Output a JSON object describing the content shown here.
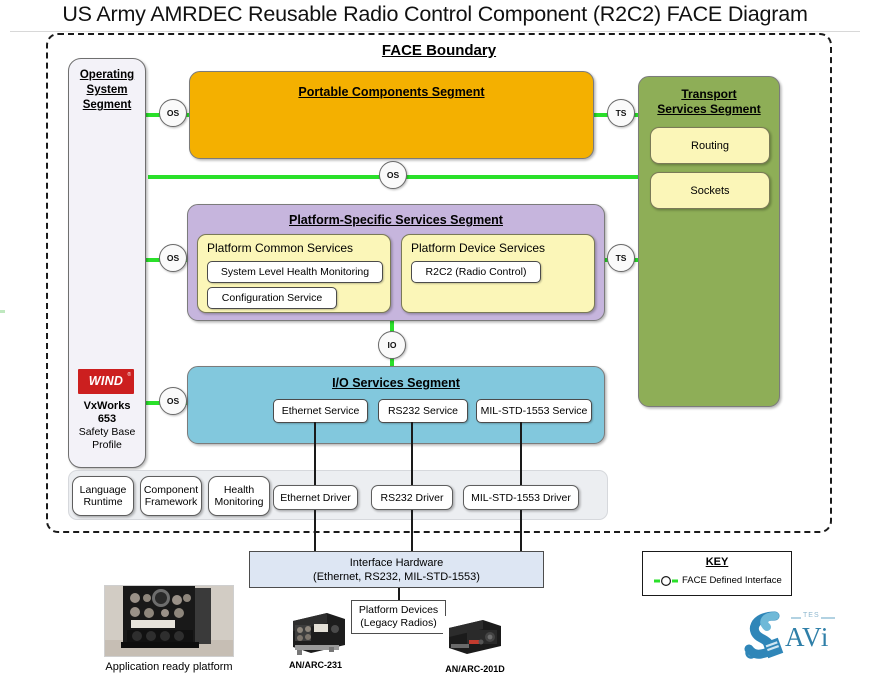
{
  "title": "US Army AMRDEC Reusable Radio Control Component (R2C2) FACE Diagram",
  "face_boundary": {
    "label": "FACE Boundary"
  },
  "os_segment": {
    "title": "Operating System Segment",
    "title_lines": [
      "Operating",
      "System",
      "Segment"
    ],
    "vendor_logo_text": "WIND",
    "vendor_logo_tm": "®",
    "os_name": "VxWorks",
    "os_version": "653",
    "os_profile_line1": "Safety Base",
    "os_profile_line2": "Profile",
    "bottom_boxes": [
      {
        "line1": "Language",
        "line2": "Runtime"
      },
      {
        "line1": "Component",
        "line2": "Framework"
      },
      {
        "line1": "Health",
        "line2": "Monitoring"
      }
    ]
  },
  "portable_components_segment": {
    "title": "Portable Components Segment",
    "color": "#f4b000"
  },
  "platform_specific_segment": {
    "title": "Platform-Specific Services Segment",
    "color": "#c6b5dd",
    "groups": [
      {
        "title": "Platform Common Services",
        "items": [
          "System Level Health Monitoring",
          "Configuration Service"
        ]
      },
      {
        "title": "Platform Device Services",
        "items": [
          "R2C2 (Radio Control)"
        ]
      }
    ]
  },
  "io_services_segment": {
    "title": "I/O Services Segment",
    "color": "#82c8dd",
    "services": [
      "Ethernet Service",
      "RS232 Service",
      "MIL-STD-1553 Service"
    ]
  },
  "transport_services_segment": {
    "title": "Transport Services Segment",
    "title_lines": [
      "Transport",
      "Services Segment"
    ],
    "color": "#8eae57",
    "items": [
      "Routing",
      "Sockets"
    ]
  },
  "drivers": [
    "Ethernet  Driver",
    "RS232 Driver",
    "MIL-STD-1553 Driver"
  ],
  "interfaces": [
    {
      "id": "os-iface-pcs",
      "label": "OS"
    },
    {
      "id": "os-iface-bus",
      "label": "OS"
    },
    {
      "id": "os-iface-pss",
      "label": "OS"
    },
    {
      "id": "os-iface-ios",
      "label": "OS"
    },
    {
      "id": "ts-iface-pcs",
      "label": "TS"
    },
    {
      "id": "ts-iface-pss",
      "label": "TS"
    },
    {
      "id": "io-iface",
      "label": "IO"
    }
  ],
  "interface_hardware": {
    "line1": "Interface Hardware",
    "line2": "(Ethernet, RS232, MIL-STD-1553)"
  },
  "platform_devices": {
    "line1": "Platform Devices",
    "line2": "(Legacy Radios)"
  },
  "key": {
    "title": "KEY",
    "entry_label": "FACE Defined Interface",
    "interface_color": "#2ae02a"
  },
  "photos": {
    "app_ready_platform_caption": "Application ready platform",
    "radio_left_caption": "AN/ARC-231",
    "radio_right_caption": "AN/ARC-201D"
  },
  "savi_logo": {
    "top_text": "TES",
    "word": "AVi"
  }
}
